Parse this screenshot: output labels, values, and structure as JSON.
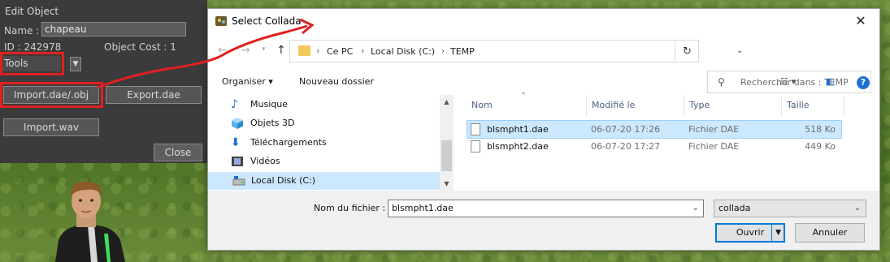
{
  "edit_panel": {
    "title": "Edit Object",
    "name_label": "Name :",
    "name_value": "chapeau",
    "id_text": "ID : 242978",
    "cost_text": "Object Cost : 1",
    "tools_value": "Tools",
    "import_label": "Import.dae/.obj",
    "export_label": "Export.dae",
    "import_wav_label": "Import.wav",
    "close_label": "Close"
  },
  "dialog": {
    "title": "Select Collada",
    "breadcrumbs": [
      "Ce PC",
      "Local Disk (C:)",
      "TEMP"
    ],
    "search_placeholder": "Rechercher dans : TEMP",
    "toolbar": {
      "organize_label": "Organiser",
      "new_folder_label": "Nouveau dossier"
    },
    "nav_items": [
      {
        "label": "Musique",
        "icon": "music-icon"
      },
      {
        "label": "Objets 3D",
        "icon": "cube-icon"
      },
      {
        "label": "Téléchargements",
        "icon": "download-icon"
      },
      {
        "label": "Vidéos",
        "icon": "video-icon"
      },
      {
        "label": "Local Disk (C:)",
        "icon": "drive-icon"
      }
    ],
    "columns": [
      "Nom",
      "Modifié le",
      "Type",
      "Taille"
    ],
    "files": [
      {
        "name": "blsmpht1.dae",
        "modified": "06-07-20 17:26",
        "type": "Fichier DAE",
        "size": "518 Ko"
      },
      {
        "name": "blsmpht2.dae",
        "modified": "06-07-20 17:27",
        "type": "Fichier DAE",
        "size": "449 Ko"
      }
    ],
    "filename_label": "Nom du fichier :",
    "filename_value": "blsmpht1.dae",
    "filetype_value": "collada",
    "open_label": "Ouvrir",
    "cancel_label": "Annuler"
  },
  "colors": {
    "highlight_red": "#e02020",
    "selection_blue": "#cce8ff",
    "accent_blue": "#0078d7"
  }
}
